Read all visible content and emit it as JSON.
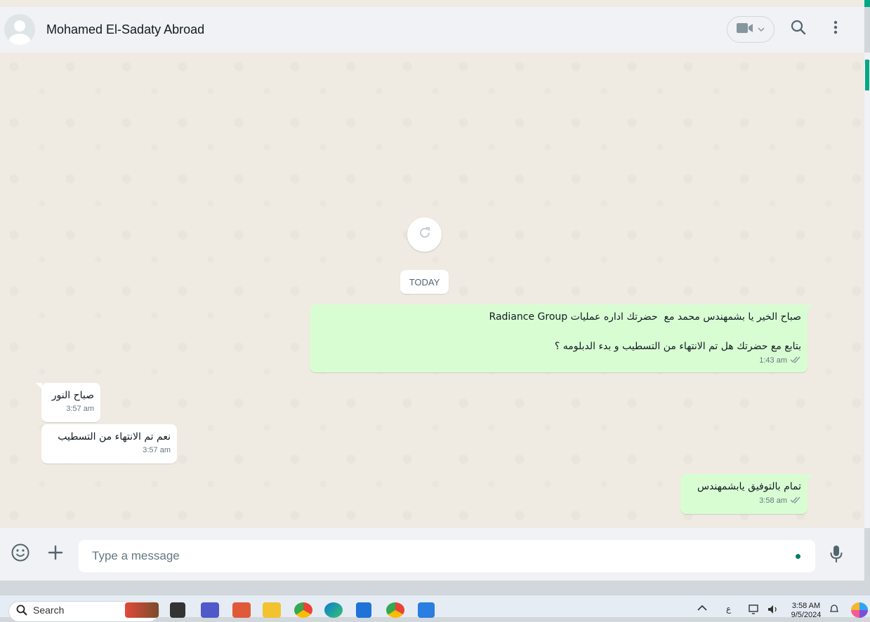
{
  "header": {
    "contact_name": "Mohamed El-Sadaty Abroad",
    "icons": [
      "avatar-default",
      "video-camera-icon",
      "chevron-down-icon",
      "search-icon",
      "kebab-menu-icon"
    ]
  },
  "chat": {
    "date_chip": "TODAY",
    "messages": [
      {
        "direction": "out",
        "line1": "صباح الخير يا بشمهندس محمد مع  حضرتك اداره عمليات Radiance Group",
        "line2": "بتابع مع حضرتك هل تم الانتهاء من التسطيب و بدء الدبلومه ؟",
        "time": "1:43 am",
        "status": "read"
      },
      {
        "direction": "in",
        "text": "صباح النور",
        "time": "3:57 am"
      },
      {
        "direction": "in",
        "text": "نعم تم الانتهاء من التسطيب",
        "time": "3:57 am"
      },
      {
        "direction": "out",
        "text": "تمام بالتوفيق يابشمهندس",
        "time": "3:58 am",
        "status": "read"
      }
    ]
  },
  "composer": {
    "placeholder": "Type a message",
    "icons": [
      "emoji-icon",
      "plus-icon",
      "microphone-icon"
    ]
  },
  "taskbar": {
    "search_label": "Search",
    "language_indicator": "ع",
    "time": "3:58 AM",
    "date": "9/5/2024"
  },
  "colors": {
    "accent": "#00a884",
    "outgoing_bubble": "#d9fdd3",
    "incoming_bubble": "#ffffff",
    "chat_background": "#efeae2",
    "header_background": "#f0f2f5"
  }
}
